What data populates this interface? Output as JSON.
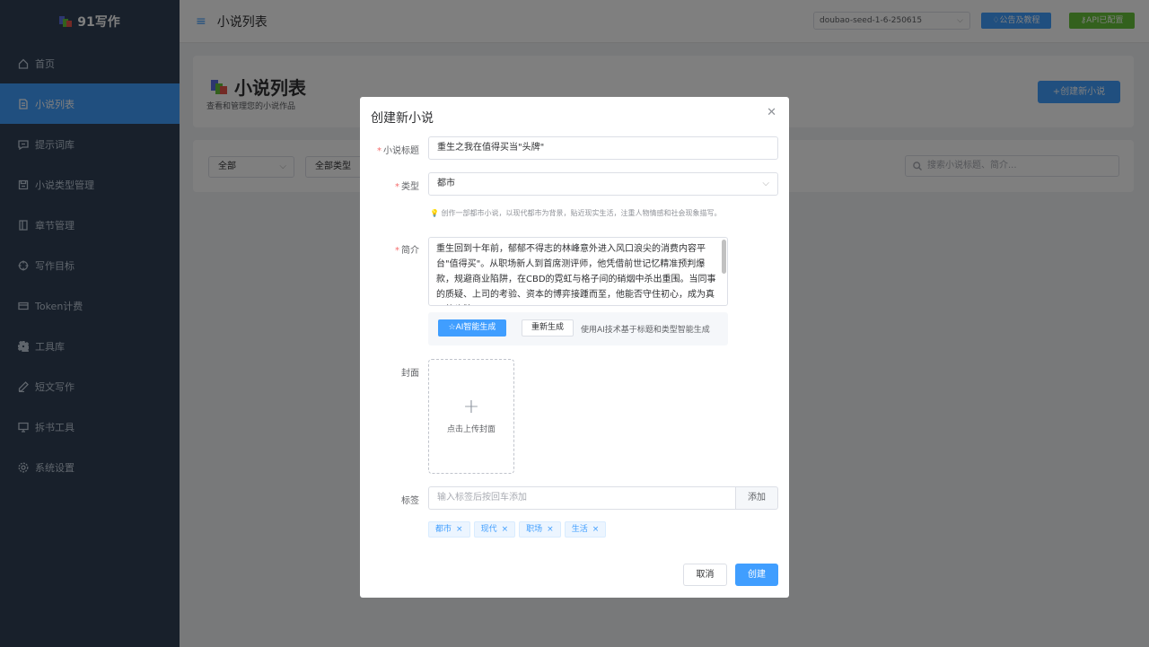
{
  "app": {
    "name": "91写作"
  },
  "sidebar": {
    "items": [
      {
        "label": "首页",
        "icon": "home-icon"
      },
      {
        "label": "小说列表",
        "icon": "document-icon"
      },
      {
        "label": "提示词库",
        "icon": "chat-icon"
      },
      {
        "label": "小说类型管理",
        "icon": "save-icon"
      },
      {
        "label": "章节管理",
        "icon": "book-icon"
      },
      {
        "label": "写作目标",
        "icon": "target-icon"
      },
      {
        "label": "Token计费",
        "icon": "wallet-icon"
      },
      {
        "label": "工具库",
        "icon": "gear-icon"
      },
      {
        "label": "短文写作",
        "icon": "pen-icon"
      },
      {
        "label": "拆书工具",
        "icon": "monitor-icon"
      },
      {
        "label": "系统设置",
        "icon": "settings-icon"
      }
    ],
    "active_index": 1
  },
  "header": {
    "title": "小说列表",
    "model": "doubao-seed-1-6-250615",
    "notice_button": "公告及教程",
    "api_button": "API已配置"
  },
  "page": {
    "title": "小说列表",
    "subtitle": "查看和管理您的小说作品",
    "create_button": "+创建新小说",
    "filter_status": "全部",
    "filter_type": "全部类型",
    "search_placeholder": "搜索小说标题、简介..."
  },
  "dialog": {
    "title": "创建新小说",
    "title_label": "小说标题",
    "title_value": "重生之我在值得买当\"头牌\"",
    "type_label": "类型",
    "type_value": "都市",
    "type_tip": "创作一部都市小说，以现代都市为背景，贴近现实生活，注重人物情感和社会现象描写。",
    "intro_label": "简介",
    "intro_value": "重生回到十年前，郁郁不得志的林峰意外进入风口浪尖的消费内容平台\"值得买\"。从职场新人到首席测评师，他凭借前世记忆精准预判爆款，规避商业陷阱，在CBD的霓虹与格子间的硝烟中杀出重围。当同事的质疑、上司的考验、资本的博弈接踵而至，他能否守住初心，成为真正的头牌？",
    "ai_button": "AI智能生成",
    "regen_button": "重新生成",
    "ai_hint": "使用AI技术基于标题和类型智能生成",
    "cover_label": "封面",
    "cover_upload_text": "点击上传封面",
    "tags_label": "标签",
    "tags_placeholder": "输入标签后按回车添加",
    "tags_add_button": "添加",
    "tags": [
      "都市",
      "现代",
      "职场",
      "生活"
    ],
    "cancel_button": "取消",
    "confirm_button": "创建"
  },
  "colors": {
    "primary": "#409eff",
    "success": "#67c23a",
    "sidebar": "#304156",
    "danger": "#f56c6c"
  }
}
